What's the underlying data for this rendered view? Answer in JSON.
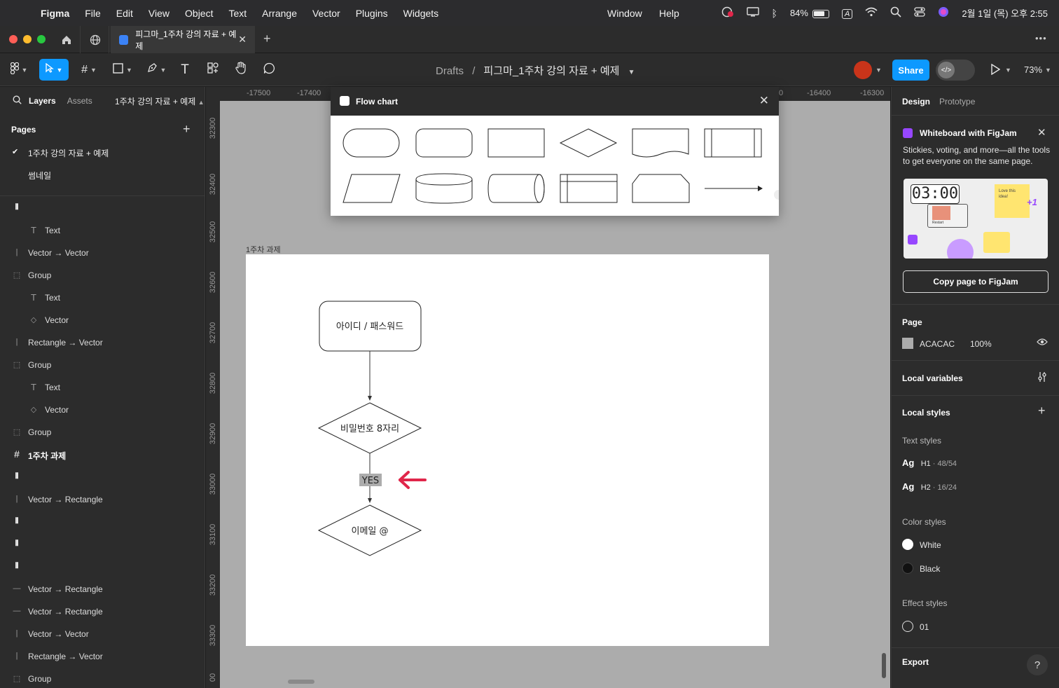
{
  "menubar": {
    "app": "Figma",
    "items": [
      "File",
      "Edit",
      "View",
      "Object",
      "Text",
      "Arrange",
      "Vector",
      "Plugins",
      "Widgets"
    ],
    "right_items": [
      "Window",
      "Help"
    ],
    "battery": "84%",
    "input_source": "A",
    "datetime": "2월 1일 (목) 오후 2:55"
  },
  "tabbar": {
    "active_tab": "피그마_1주차 강의 자료 + 예제",
    "close": "✕",
    "add": "+",
    "more": "•••"
  },
  "toolbar": {
    "breadcrumb_root": "Drafts",
    "separator": "/",
    "file_name": "피그마_1주차 강의 자료 + 예제",
    "share_label": "Share",
    "zoom": "73%"
  },
  "left_panel": {
    "tab_layers": "Layers",
    "tab_assets": "Assets",
    "page_selector": "1주차 강의 자료 + 예제",
    "pages_header": "Pages",
    "pages": [
      "1주차 강의 자료 + 예제",
      "썸네일"
    ],
    "layers": [
      {
        "label": "",
        "icon": "component-icon",
        "indent": 0
      },
      {
        "label": "Text",
        "icon": "text-icon",
        "indent": 1
      },
      {
        "label": "Vector → Vector",
        "icon": "line-icon",
        "indent": 0
      },
      {
        "label": "Group",
        "icon": "group-icon",
        "indent": 0
      },
      {
        "label": "Text",
        "icon": "text-icon",
        "indent": 1
      },
      {
        "label": "Vector",
        "icon": "vector-icon",
        "indent": 1
      },
      {
        "label": "Rectangle → Vector",
        "icon": "line-icon",
        "indent": 0
      },
      {
        "label": "Group",
        "icon": "group-icon",
        "indent": 0
      },
      {
        "label": "Text",
        "icon": "text-icon",
        "indent": 1
      },
      {
        "label": "Vector",
        "icon": "vector-icon",
        "indent": 1
      },
      {
        "label": "Group",
        "icon": "group-icon",
        "indent": 0
      },
      {
        "label": "1주차 과제",
        "icon": "frame-icon",
        "indent": 0,
        "bold": true
      },
      {
        "label": "",
        "icon": "component-icon",
        "indent": 0
      },
      {
        "label": "Vector → Rectangle",
        "icon": "line-icon",
        "indent": 0
      },
      {
        "label": "",
        "icon": "component-icon",
        "indent": 0
      },
      {
        "label": "",
        "icon": "component-icon",
        "indent": 0
      },
      {
        "label": "",
        "icon": "component-icon",
        "indent": 0
      },
      {
        "label": "Vector → Rectangle",
        "icon": "hline-icon",
        "indent": 0
      },
      {
        "label": "Vector → Rectangle",
        "icon": "hline-icon",
        "indent": 0
      },
      {
        "label": "Vector → Vector",
        "icon": "line-icon",
        "indent": 0
      },
      {
        "label": "Rectangle → Vector",
        "icon": "line-icon",
        "indent": 0
      },
      {
        "label": "Group",
        "icon": "group-icon",
        "indent": 0
      }
    ]
  },
  "canvas": {
    "ruler_x": [
      "-17500",
      "-17400",
      "0",
      "-16400",
      "-16300"
    ],
    "ruler_y": [
      "32300",
      "32400",
      "32500",
      "32600",
      "32700",
      "32800",
      "32900",
      "33000",
      "33100",
      "33200",
      "33300",
      "00"
    ],
    "frame_label": "1주차 과제",
    "flow": {
      "node1": "아이디 / 패스워드",
      "node2": "비밀번호 8자리",
      "yes_label": "YES",
      "node3": "이메일 @"
    },
    "arrow_color": "#e0264a"
  },
  "plugin": {
    "title": "Flow chart",
    "close": "✕"
  },
  "right_panel": {
    "tab_design": "Design",
    "tab_prototype": "Prototype",
    "figjam_title": "Whiteboard with FigJam",
    "figjam_desc": "Stickies, voting, and more—all the tools to get everyone on the same page.",
    "thumb_timer": "03:00",
    "thumb_sticky": "Love this idea!",
    "thumb_restart": "Restart",
    "thumb_plus": "+1",
    "copy_button": "Copy page to FigJam",
    "page_header": "Page",
    "page_color": "ACACAC",
    "page_opacity": "100%",
    "local_variables": "Local variables",
    "local_styles": "Local styles",
    "text_styles_header": "Text styles",
    "text_styles": [
      {
        "sample": "Ag",
        "name": "H1",
        "meta": " · 48/54"
      },
      {
        "sample": "Ag",
        "name": "H2",
        "meta": " · 16/24"
      }
    ],
    "color_styles_header": "Color styles",
    "color_styles": [
      {
        "name": "White",
        "color": "#ffffff"
      },
      {
        "name": "Black",
        "color": "#111111"
      }
    ],
    "effect_styles_header": "Effect styles",
    "effect_styles": [
      {
        "name": "01"
      }
    ],
    "export_header": "Export",
    "help": "?"
  }
}
